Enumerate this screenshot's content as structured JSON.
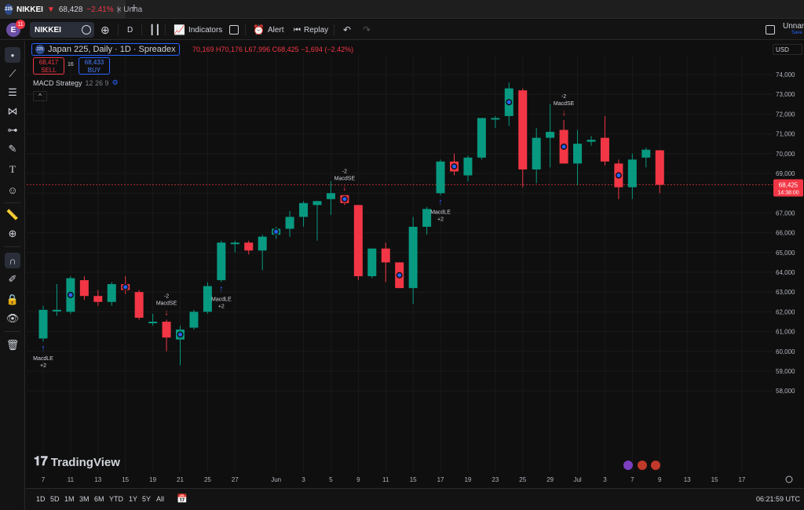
{
  "tab": {
    "symbol": "NIKKEI",
    "arrow": "▼",
    "price": "68,428",
    "change": "−2.41%",
    "separator": "|",
    "name": "Unna",
    "logo": "225",
    "close": "×",
    "new": "+"
  },
  "toolbar": {
    "avatar": "E",
    "notifications": "11",
    "symbol": "NIKKEI",
    "interval": "D",
    "indicators": "Indicators",
    "alert": "Alert",
    "replay": "Replay",
    "layout_name": "Unnam",
    "save_label": "Save"
  },
  "legend": {
    "logo": "225",
    "title": "Japan 225, Daily · 1D · Spreadex",
    "ohlc": "70,169  H70,176  L67,996  C68,425  −1,694  (−2.42%)",
    "sell_price": "68,417",
    "sell_label": "SELL",
    "spread": "16",
    "buy_price": "68,433",
    "buy_label": "BUY",
    "strategy_name": "MACD Strategy",
    "strategy_params": "12 26 9",
    "collapse": "^"
  },
  "currency": "USD",
  "branding": "TradingView",
  "last_price": {
    "price": "68,425",
    "countdown": "14:38:00"
  },
  "bottom": {
    "ranges": [
      "1D",
      "5D",
      "1M",
      "3M",
      "6M",
      "YTD",
      "1Y",
      "5Y",
      "All"
    ],
    "time": "06:21:59 UTC"
  },
  "colors": {
    "up": "#089981",
    "down": "#f23645",
    "background": "#0f0f0f",
    "grid": "#1a1a1a",
    "accent": "#2962ff"
  },
  "icons": {
    "tab_logo": "nikkei-logo",
    "left_toolbar": [
      "cursor-icon",
      "trendline-icon",
      "fib-icon",
      "pattern-icon",
      "projection-icon",
      "brush-icon",
      "text-icon",
      "emoji-icon",
      "ruler-icon",
      "zoom-icon",
      "magnet-icon",
      "lock-drawing-icon",
      "lock-icon",
      "eye-icon",
      "trash-icon"
    ]
  },
  "chart_data": {
    "type": "candlestick",
    "title": "Japan 225, Daily · 1D · Spreadex",
    "ylim": [
      57800,
      74500
    ],
    "y_ticks": [
      58000,
      59000,
      60000,
      61000,
      62000,
      63000,
      64000,
      65000,
      66000,
      67000,
      68000,
      69000,
      70000,
      71000,
      72000,
      73000,
      74000
    ],
    "y_tick_labels": [
      "58,000",
      "59,000",
      "60,000",
      "61,000",
      "62,000",
      "63,000",
      "64,000",
      "65,000",
      "66,000",
      "67,000",
      "68,000",
      "69,000",
      "70,000",
      "71,000",
      "72,000",
      "73,000",
      "74,000"
    ],
    "x_ticks": [
      {
        "slot": 0,
        "label": "7"
      },
      {
        "slot": 2,
        "label": "11"
      },
      {
        "slot": 4,
        "label": "13"
      },
      {
        "slot": 6,
        "label": "15"
      },
      {
        "slot": 8,
        "label": "19"
      },
      {
        "slot": 10,
        "label": "21"
      },
      {
        "slot": 12,
        "label": "25"
      },
      {
        "slot": 14,
        "label": "27"
      },
      {
        "slot": 17,
        "label": "Jun"
      },
      {
        "slot": 19,
        "label": "3"
      },
      {
        "slot": 21,
        "label": "5"
      },
      {
        "slot": 23,
        "label": "9"
      },
      {
        "slot": 25,
        "label": "11"
      },
      {
        "slot": 27,
        "label": "15"
      },
      {
        "slot": 29,
        "label": "17"
      },
      {
        "slot": 31,
        "label": "19"
      },
      {
        "slot": 33,
        "label": "23"
      },
      {
        "slot": 35,
        "label": "25"
      },
      {
        "slot": 37,
        "label": "29"
      },
      {
        "slot": 39,
        "label": "Jul"
      },
      {
        "slot": 41,
        "label": "3"
      },
      {
        "slot": 43,
        "label": "7"
      },
      {
        "slot": 45,
        "label": "9"
      },
      {
        "slot": 47,
        "label": "13"
      },
      {
        "slot": 49,
        "label": "15"
      },
      {
        "slot": 51,
        "label": "17"
      }
    ],
    "last_price": 68425,
    "candles": [
      {
        "o": 60650,
        "h": 62300,
        "l": 60500,
        "c": 62100
      },
      {
        "o": 62050,
        "h": 63400,
        "l": 61800,
        "c": 62100
      },
      {
        "o": 62000,
        "h": 63800,
        "l": 61900,
        "c": 63700
      },
      {
        "o": 63600,
        "h": 63800,
        "l": 62600,
        "c": 62800
      },
      {
        "o": 62800,
        "h": 63100,
        "l": 62300,
        "c": 62500
      },
      {
        "o": 62500,
        "h": 63500,
        "l": 62300,
        "c": 63400
      },
      {
        "o": 63400,
        "h": 63800,
        "l": 62900,
        "c": 63100
      },
      {
        "o": 63000,
        "h": 63100,
        "l": 61600,
        "c": 61700
      },
      {
        "o": 61500,
        "h": 61900,
        "l": 61300,
        "c": 61500
      },
      {
        "o": 61500,
        "h": 61600,
        "l": 60000,
        "c": 60700
      },
      {
        "o": 60600,
        "h": 61300,
        "l": 59300,
        "c": 61100
      },
      {
        "o": 61200,
        "h": 62100,
        "l": 61100,
        "c": 62000
      },
      {
        "o": 62000,
        "h": 63500,
        "l": 61900,
        "c": 63300
      },
      {
        "o": 63600,
        "h": 65600,
        "l": 63500,
        "c": 65500
      },
      {
        "o": 65500,
        "h": 65600,
        "l": 65000,
        "c": 65500
      },
      {
        "o": 65500,
        "h": 65600,
        "l": 64900,
        "c": 65100
      },
      {
        "o": 65100,
        "h": 65900,
        "l": 64100,
        "c": 65800
      },
      {
        "o": 65900,
        "h": 66300,
        "l": 65700,
        "c": 66200
      },
      {
        "o": 66200,
        "h": 67100,
        "l": 65800,
        "c": 66800
      },
      {
        "o": 66800,
        "h": 67600,
        "l": 66300,
        "c": 67500
      },
      {
        "o": 67400,
        "h": 67600,
        "l": 65600,
        "c": 67600
      },
      {
        "o": 67700,
        "h": 68600,
        "l": 66900,
        "c": 68000
      },
      {
        "o": 67900,
        "h": 67900,
        "l": 67400,
        "c": 67500
      },
      {
        "o": 67400,
        "h": 67400,
        "l": 63600,
        "c": 63800
      },
      {
        "o": 63800,
        "h": 65200,
        "l": 63700,
        "c": 65200
      },
      {
        "o": 65200,
        "h": 65500,
        "l": 63500,
        "c": 64500
      },
      {
        "o": 64500,
        "h": 64500,
        "l": 63300,
        "c": 63200
      },
      {
        "o": 63200,
        "h": 66800,
        "l": 62400,
        "c": 66300
      },
      {
        "o": 66300,
        "h": 67300,
        "l": 65900,
        "c": 67200
      },
      {
        "o": 68000,
        "h": 69700,
        "l": 67900,
        "c": 69600
      },
      {
        "o": 69600,
        "h": 70000,
        "l": 68900,
        "c": 69100
      },
      {
        "o": 68900,
        "h": 69900,
        "l": 68600,
        "c": 69800
      },
      {
        "o": 69800,
        "h": 71800,
        "l": 69700,
        "c": 71800
      },
      {
        "o": 71800,
        "h": 71900,
        "l": 71300,
        "c": 71800
      },
      {
        "o": 71900,
        "h": 73600,
        "l": 71400,
        "c": 73300
      },
      {
        "o": 73200,
        "h": 73300,
        "l": 68300,
        "c": 69200
      },
      {
        "o": 69200,
        "h": 71300,
        "l": 68500,
        "c": 70800
      },
      {
        "o": 70800,
        "h": 72500,
        "l": 69300,
        "c": 71100
      },
      {
        "o": 71200,
        "h": 71700,
        "l": 69500,
        "c": 69500
      },
      {
        "o": 69500,
        "h": 71200,
        "l": 68400,
        "c": 70500
      },
      {
        "o": 70600,
        "h": 70900,
        "l": 70400,
        "c": 70700
      },
      {
        "o": 70800,
        "h": 71900,
        "l": 69400,
        "c": 69600
      },
      {
        "o": 69500,
        "h": 69700,
        "l": 67700,
        "c": 68300
      },
      {
        "o": 68300,
        "h": 70000,
        "l": 67700,
        "c": 69700
      },
      {
        "o": 69800,
        "h": 70300,
        "l": 69300,
        "c": 70200
      },
      {
        "o": 70169,
        "h": 70176,
        "l": 67996,
        "c": 68425
      }
    ],
    "markers": [
      {
        "slot": 0,
        "type": "long",
        "label": "MacdLE",
        "qty": "+2"
      },
      {
        "slot": 9,
        "type": "short",
        "label": "MacdSE",
        "qty": "-2"
      },
      {
        "slot": 13,
        "type": "long",
        "label": "MacdLE",
        "qty": "+2"
      },
      {
        "slot": 22,
        "type": "short",
        "label": "MacdSE",
        "qty": "-2"
      },
      {
        "slot": 29,
        "type": "long",
        "label": "MacdLE",
        "qty": "+2"
      },
      {
        "slot": 38,
        "type": "short",
        "label": "MacdSE",
        "qty": "-2"
      }
    ],
    "dots": [
      2,
      6,
      10,
      17,
      22,
      26,
      30,
      34,
      38,
      42
    ],
    "icons_bottom": [
      "lightning-icon",
      "flag-us-icon",
      "flag-us-icon"
    ]
  }
}
